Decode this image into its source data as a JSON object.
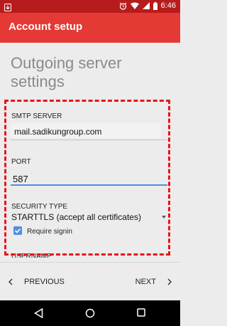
{
  "status_bar": {
    "time": "6:46",
    "icons": [
      "notification-icon",
      "alarm-icon",
      "wifi-icon",
      "signal-icon",
      "battery-icon"
    ]
  },
  "toolbar": {
    "title": "Account setup"
  },
  "page": {
    "title": "Outgoing server settings"
  },
  "form": {
    "smtp": {
      "label": "SMTP SERVER",
      "value": "mail.sadikungroup.com"
    },
    "port": {
      "label": "PORT",
      "value": "587"
    },
    "security": {
      "label": "SECURITY TYPE",
      "value": "STARTTLS (accept all certificates)"
    },
    "require_signin": {
      "label": "Require signin",
      "checked": true
    },
    "username": {
      "label": "USERNAME"
    }
  },
  "nav": {
    "previous": "PREVIOUS",
    "next": "NEXT"
  },
  "colors": {
    "status_bar": "#b71c1c",
    "toolbar": "#e53935",
    "accent": "#4e8fe0",
    "highlight": "#e8141c"
  }
}
